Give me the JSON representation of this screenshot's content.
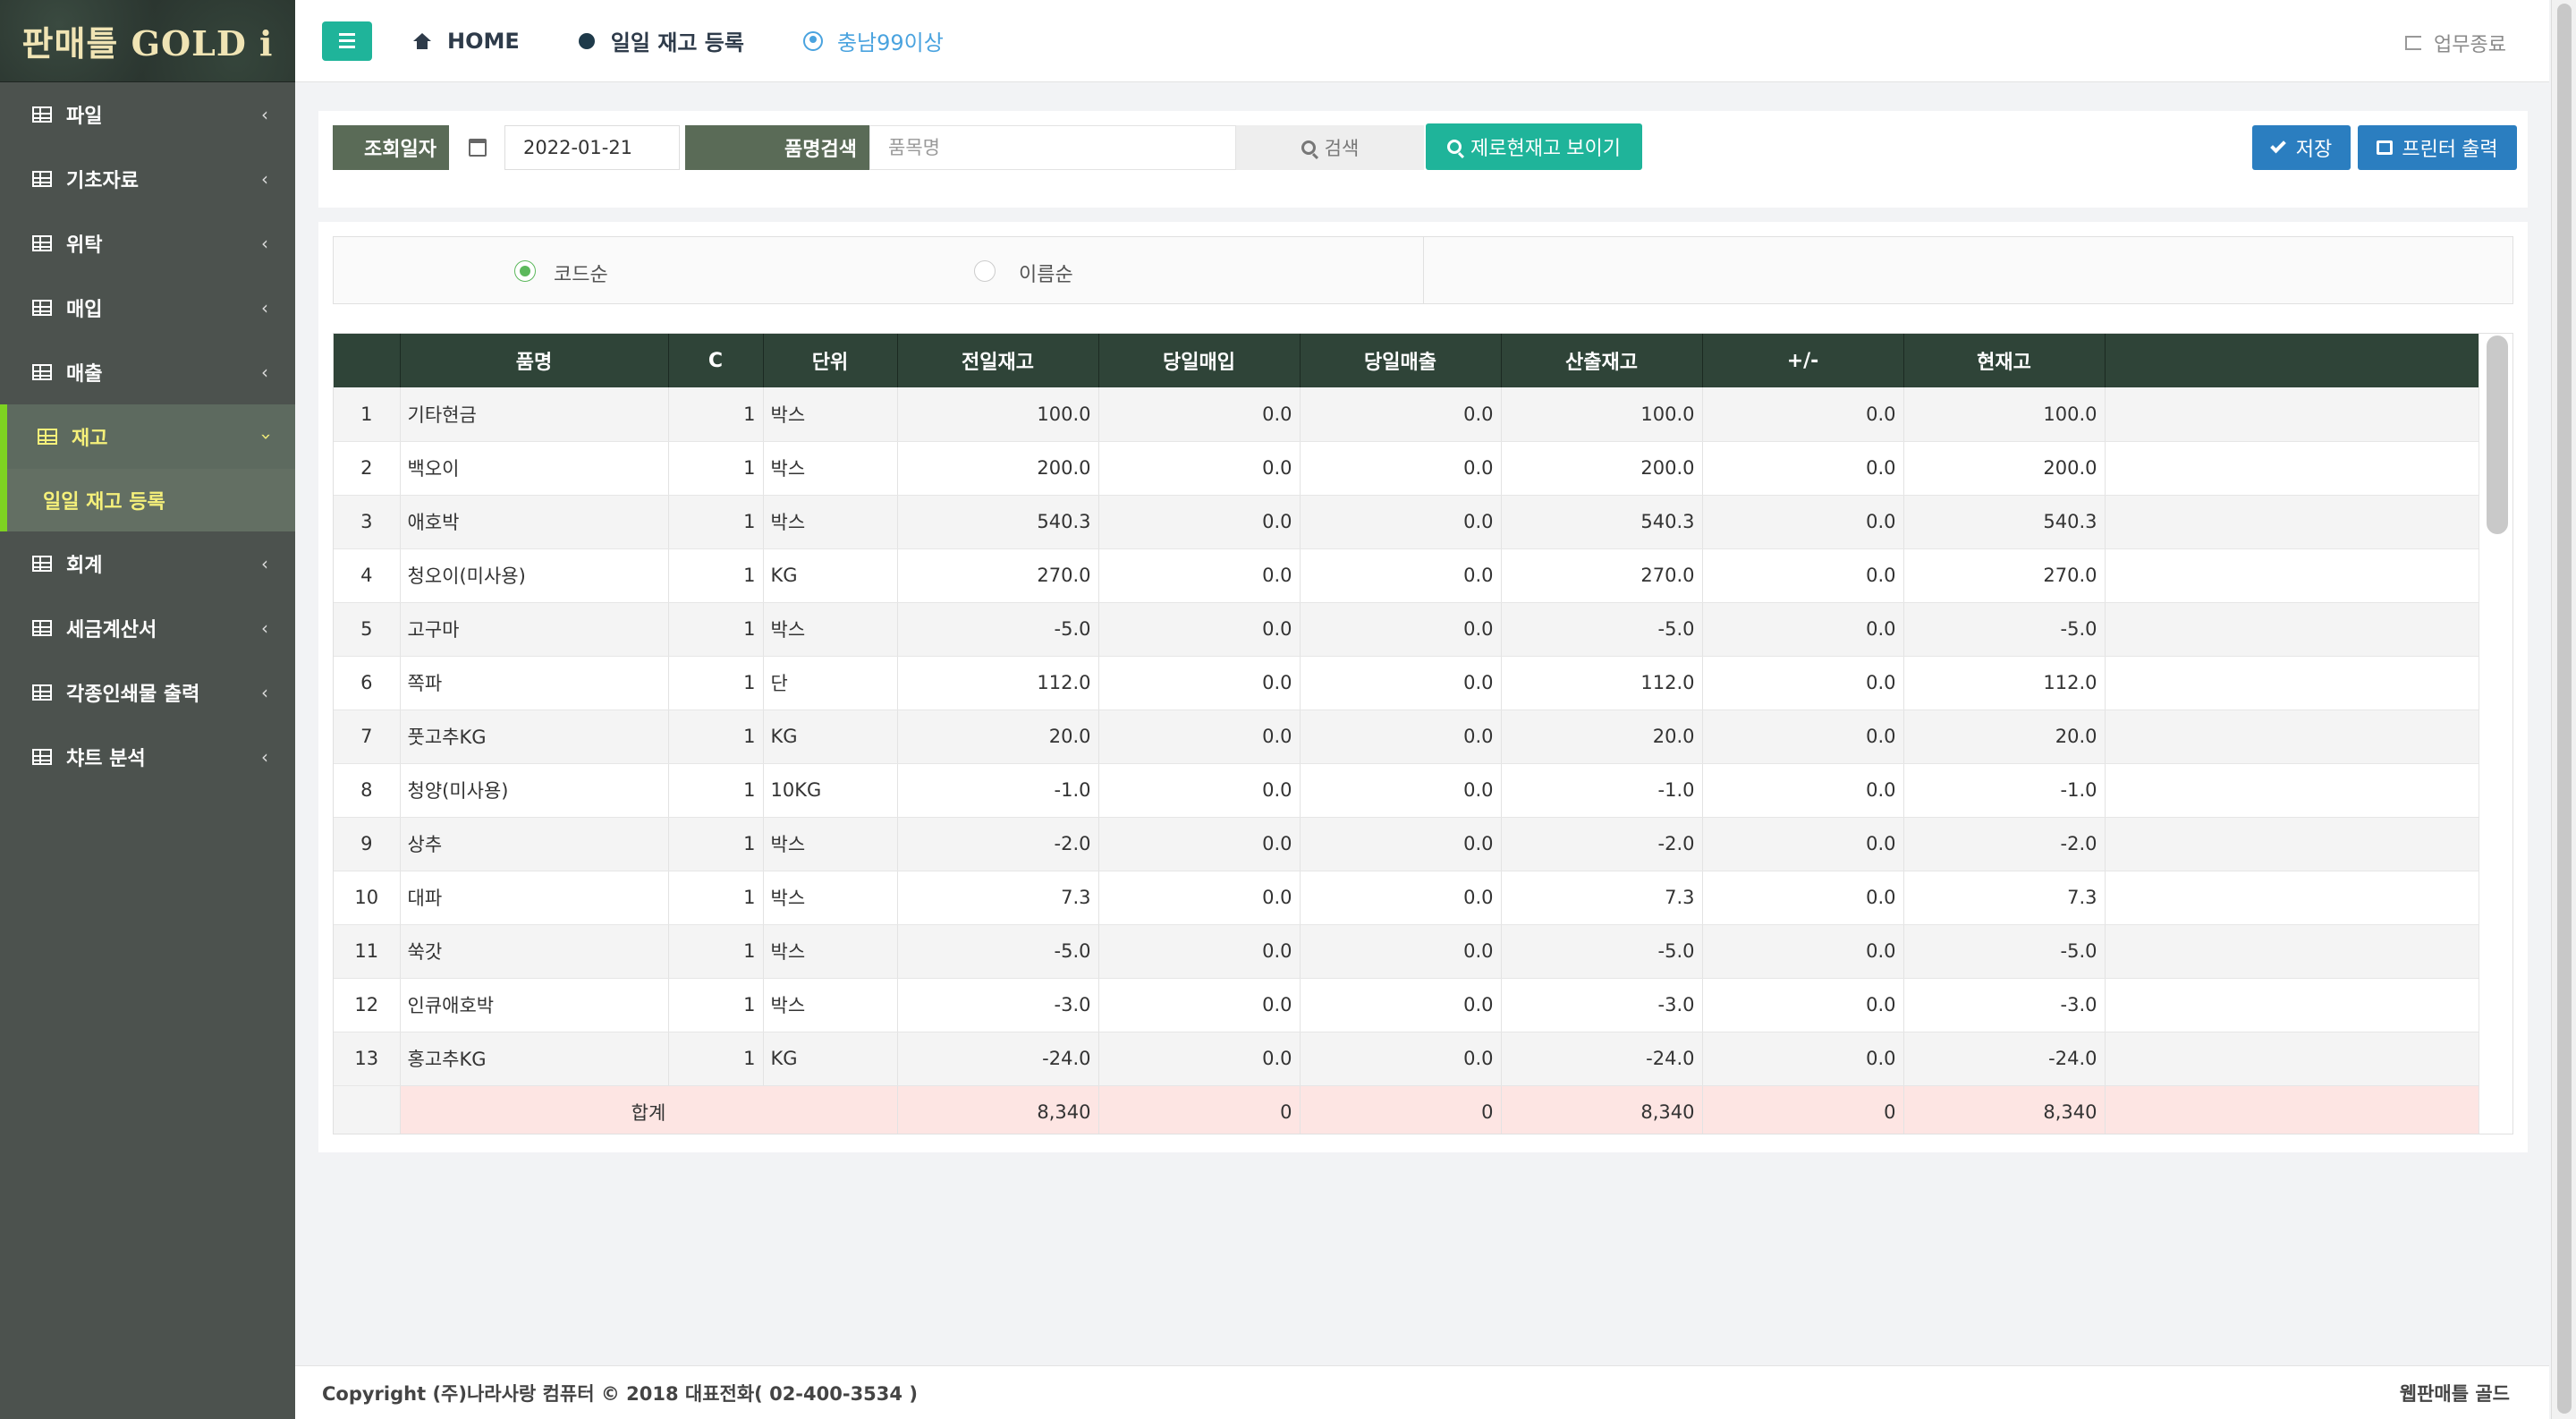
{
  "app": {
    "logo_text": "판매틀 GOLD i"
  },
  "sidebar": {
    "items": [
      {
        "label": "파일",
        "icon": "table-icon"
      },
      {
        "label": "기초자료",
        "icon": "table-icon"
      },
      {
        "label": "위탁",
        "icon": "table-icon"
      },
      {
        "label": "매입",
        "icon": "table-icon"
      },
      {
        "label": "매출",
        "icon": "table-icon"
      },
      {
        "label": "재고",
        "icon": "table-icon",
        "active": true
      },
      {
        "label": "회계",
        "icon": "table-icon"
      },
      {
        "label": "세금계산서",
        "icon": "table-icon"
      },
      {
        "label": "각종인쇄물 출력",
        "icon": "table-icon"
      },
      {
        "label": "챠트 분석",
        "icon": "table-icon"
      }
    ],
    "submenu": {
      "label": "일일 재고 등록"
    }
  },
  "header": {
    "home_label": "HOME",
    "page_label": "일일 재고 등록",
    "user_label": "충남99이상",
    "logout_label": "업무종료"
  },
  "toolbar": {
    "date_label": "조회일자",
    "date_value": "2022-01-21",
    "name_label": "품명검색",
    "name_placeholder": "품목명",
    "search_label": "검색",
    "zero_label": "제로현재고 보이기",
    "save_label": "저장",
    "print_label": "프린터 출력"
  },
  "sort": {
    "by_code": "코드순",
    "by_name": "이름순",
    "selected": "코드순"
  },
  "table": {
    "columns": [
      "",
      "품명",
      "C",
      "단위",
      "전일재고",
      "당일매입",
      "당일매출",
      "산출재고",
      "+/-",
      "현재고"
    ],
    "rows": [
      [
        "1",
        "기타현금",
        "1",
        "박스",
        "100.0",
        "0.0",
        "0.0",
        "100.0",
        "0.0",
        "100.0"
      ],
      [
        "2",
        "백오이",
        "1",
        "박스",
        "200.0",
        "0.0",
        "0.0",
        "200.0",
        "0.0",
        "200.0"
      ],
      [
        "3",
        "애호박",
        "1",
        "박스",
        "540.3",
        "0.0",
        "0.0",
        "540.3",
        "0.0",
        "540.3"
      ],
      [
        "4",
        "청오이(미사용)",
        "1",
        "KG",
        "270.0",
        "0.0",
        "0.0",
        "270.0",
        "0.0",
        "270.0"
      ],
      [
        "5",
        "고구마",
        "1",
        "박스",
        "-5.0",
        "0.0",
        "0.0",
        "-5.0",
        "0.0",
        "-5.0"
      ],
      [
        "6",
        "쪽파",
        "1",
        "단",
        "112.0",
        "0.0",
        "0.0",
        "112.0",
        "0.0",
        "112.0"
      ],
      [
        "7",
        "풋고추KG",
        "1",
        "KG",
        "20.0",
        "0.0",
        "0.0",
        "20.0",
        "0.0",
        "20.0"
      ],
      [
        "8",
        "청양(미사용)",
        "1",
        "10KG",
        "-1.0",
        "0.0",
        "0.0",
        "-1.0",
        "0.0",
        "-1.0"
      ],
      [
        "9",
        "상추",
        "1",
        "박스",
        "-2.0",
        "0.0",
        "0.0",
        "-2.0",
        "0.0",
        "-2.0"
      ],
      [
        "10",
        "대파",
        "1",
        "박스",
        "7.3",
        "0.0",
        "0.0",
        "7.3",
        "0.0",
        "7.3"
      ],
      [
        "11",
        "쑥갓",
        "1",
        "박스",
        "-5.0",
        "0.0",
        "0.0",
        "-5.0",
        "0.0",
        "-5.0"
      ],
      [
        "12",
        "인큐애호박",
        "1",
        "박스",
        "-3.0",
        "0.0",
        "0.0",
        "-3.0",
        "0.0",
        "-3.0"
      ],
      [
        "13",
        "홍고추KG",
        "1",
        "KG",
        "-24.0",
        "0.0",
        "0.0",
        "-24.0",
        "0.0",
        "-24.0"
      ]
    ],
    "total": {
      "label": "합계",
      "prev_stock": "8,340",
      "purchase": "0",
      "sales": "0",
      "calc_stock": "8,340",
      "adjust": "0",
      "current": "8,340"
    }
  },
  "footer": {
    "copyright": "Copyright (주)나라사랑 컴퓨터 © 2018 대표전화( 02-400-3534 )",
    "brand": "웹판매틀 골드"
  }
}
